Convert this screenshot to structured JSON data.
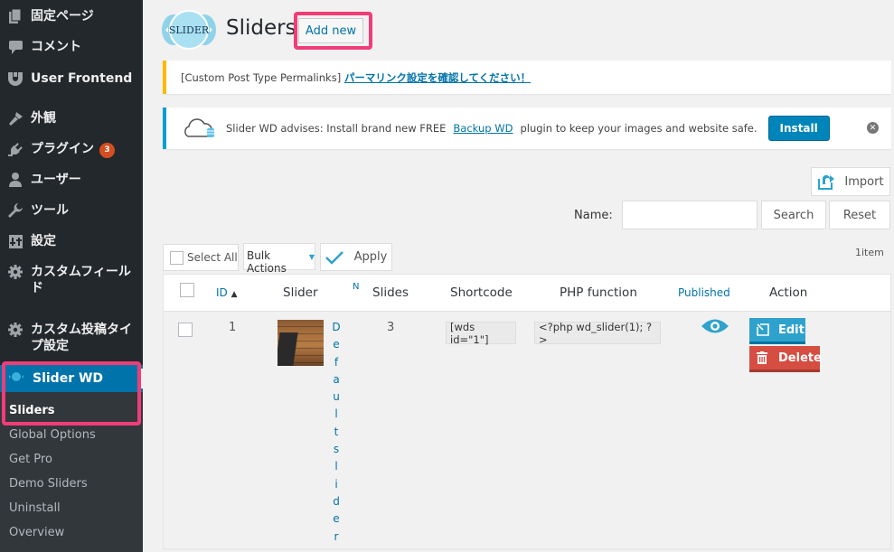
{
  "sidebar": {
    "items": [
      {
        "label": "固定ページ",
        "icon": "pages-icon"
      },
      {
        "label": "コメント",
        "icon": "comment-icon"
      },
      {
        "label": "User Frontend",
        "icon": "user-frontend-icon"
      },
      {
        "label": "外観",
        "icon": "appearance-brush-icon"
      },
      {
        "label": "プラグイン",
        "icon": "plugin-icon",
        "badge": "3"
      },
      {
        "label": "ユーザー",
        "icon": "user-icon"
      },
      {
        "label": "ツール",
        "icon": "wrench-icon"
      },
      {
        "label": "設定",
        "icon": "settings-sliders-icon"
      },
      {
        "label": "カスタムフィールド",
        "icon": "gear-icon"
      },
      {
        "label": "カスタム投稿タイプ設定",
        "icon": "gear-icon"
      }
    ],
    "active": {
      "label": "Slider WD",
      "icon": "slider-wd-icon"
    },
    "submenu": [
      "Sliders",
      "Global Options",
      "Get Pro",
      "Demo Sliders",
      "Uninstall",
      "Overview"
    ],
    "current_submenu": "Sliders"
  },
  "header": {
    "logo_text": "SLIDER",
    "title": "Sliders",
    "add_new": "Add new"
  },
  "notices": {
    "permalink": {
      "prefix": "[Custom Post Type Permalinks]",
      "link": "パーマリンク設定を確認してください！"
    },
    "backup": {
      "before": "Slider WD advises: Install brand new FREE",
      "link": "Backup WD",
      "after": "plugin to keep your images and website safe.",
      "button": "Install"
    }
  },
  "toolbar": {
    "import": "Import",
    "name_label": "Name:",
    "name_value": "",
    "search": "Search",
    "reset": "Reset",
    "count": "1item",
    "select_all": "Select All",
    "bulk_actions": "Bulk Actions",
    "apply": "Apply"
  },
  "table": {
    "columns": [
      "ID",
      "Slider",
      "N",
      "Slides",
      "Shortcode",
      "PHP function",
      "Published",
      "Action"
    ],
    "sort_indicator": "▲",
    "rows": [
      {
        "id": "1",
        "name": "Defaultslider",
        "slides": "3",
        "shortcode": "[wds id=\"1\"]",
        "php": "<?php wd_slider(1); ?>",
        "published": true,
        "edit": "Edit",
        "delete": "Delete"
      }
    ]
  },
  "colors": {
    "accent": "#0073aa",
    "highlight": "#f03d77",
    "edit": "#2ea2cc",
    "delete": "#d54e41",
    "warning_border": "#ffb900",
    "info_border": "#00a0d2"
  }
}
